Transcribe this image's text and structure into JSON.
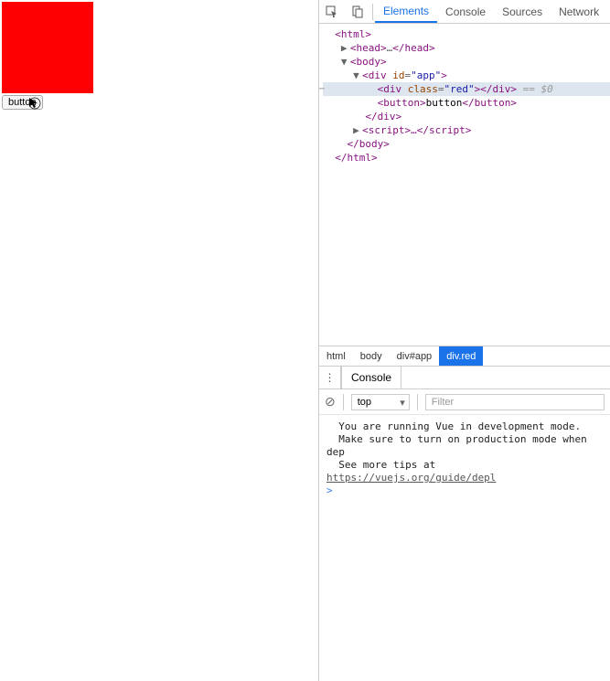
{
  "page": {
    "button_label": "button"
  },
  "devtools": {
    "tabs": {
      "elements": "Elements",
      "console": "Console",
      "sources": "Sources",
      "network": "Network"
    },
    "dom": {
      "html_open": "<html>",
      "head_collapsed": "<head>…</head>",
      "body_open": "<body>",
      "div_app_open_pre": "<div ",
      "div_app_attr_name": "id",
      "div_app_attr_val": "\"app\"",
      "div_app_open_post": ">",
      "div_red_open_pre": "<div ",
      "div_red_attr_name": "class",
      "div_red_attr_val": "\"red\"",
      "div_red_close": "></div>",
      "sel_suffix": " == $0",
      "button_open": "<button>",
      "button_text": "button",
      "button_close": "</button>",
      "div_close": "</div>",
      "script_collapsed": "<script>…</script>",
      "body_close": "</body>",
      "html_close": "</html>"
    },
    "breadcrumb": {
      "c0": "html",
      "c1": "body",
      "c2": "div#app",
      "c3": "div.red"
    },
    "console_drawer": {
      "tab": "Console",
      "context": "top",
      "filter_placeholder": "Filter",
      "msg_line1": "You are running Vue in development mode.",
      "msg_line2": "Make sure to turn on production mode when dep",
      "msg_line3_pre": "See more tips at ",
      "msg_line3_link": "https://vuejs.org/guide/depl",
      "prompt": ">"
    }
  }
}
